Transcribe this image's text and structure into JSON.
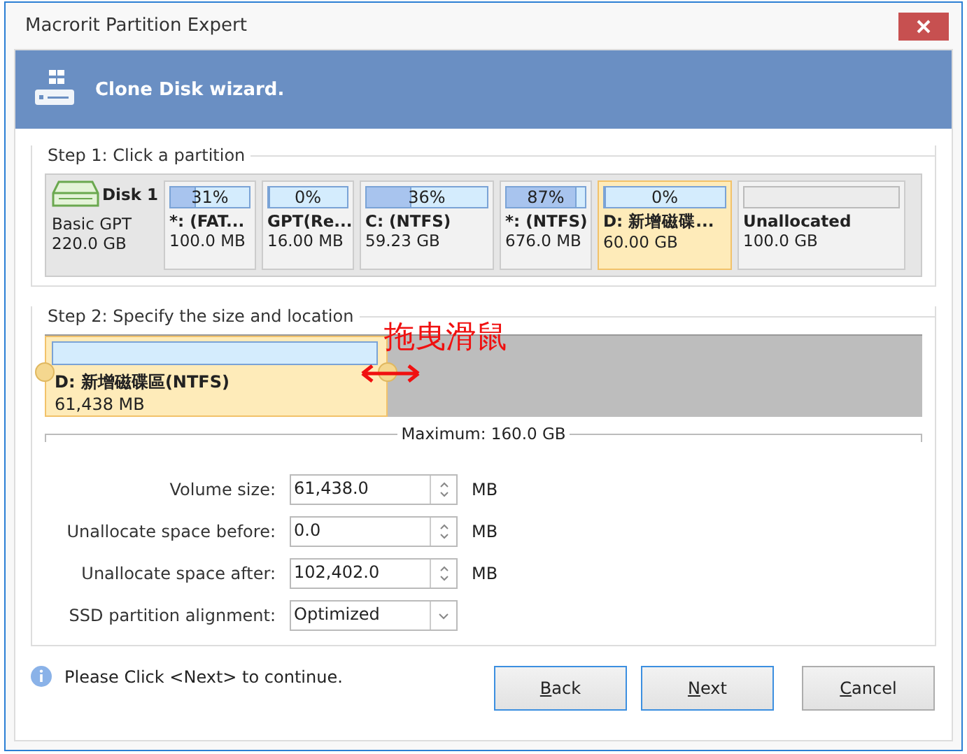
{
  "window": {
    "title": "Macrorit Partition Expert"
  },
  "header": {
    "title": "Clone Disk wizard."
  },
  "step1": {
    "legend": "Step 1: Click a partition",
    "disk": {
      "name": "Disk 1",
      "type": "Basic GPT",
      "size": "220.0 GB"
    },
    "partitions": [
      {
        "kind": "partition",
        "usage": "31%",
        "level": 0.31,
        "name": "*: (FAT...",
        "size": "100.0 MB",
        "selected": false
      },
      {
        "kind": "partition",
        "usage": "0%",
        "level": 0,
        "name": "GPT(Re...",
        "size": "16.00 MB",
        "selected": false
      },
      {
        "kind": "partition",
        "usage": "36%",
        "level": 0.36,
        "name": "C: (NTFS)",
        "size": "59.23 GB",
        "selected": false
      },
      {
        "kind": "partition",
        "usage": "87%",
        "level": 0.87,
        "name": "*: (NTFS)",
        "size": "676.0 MB",
        "selected": false
      },
      {
        "kind": "partition",
        "usage": "0%",
        "level": 0,
        "name": "D: 新增磁碟...",
        "size": "60.00 GB",
        "selected": true
      },
      {
        "kind": "unallocated",
        "name": "Unallocated",
        "size": "100.0 GB",
        "selected": false
      }
    ]
  },
  "step2": {
    "legend": "Step 2: Specify the size and location",
    "partition": {
      "name": "D: 新增磁碟區(NTFS)",
      "size": "61,438 MB",
      "level": 0.39
    },
    "annotation": "拖曳滑鼠",
    "maximum": "Maximum: 160.0 GB",
    "fields": [
      {
        "kind": "spin",
        "label": "Volume size:",
        "value": "61,438.0",
        "unit": "MB"
      },
      {
        "kind": "spin",
        "label": "Unallocate space before:",
        "value": "0.0",
        "unit": "MB"
      },
      {
        "kind": "spin",
        "label": "Unallocate space after:",
        "value": "102,402.0",
        "unit": "MB"
      },
      {
        "kind": "select",
        "label": "SSD partition alignment:",
        "value": "Optimized"
      }
    ]
  },
  "footer": {
    "info": "Please Click <Next> to continue.",
    "buttons": [
      {
        "label": "Back",
        "focused": true
      },
      {
        "label": "Next",
        "focused": true
      },
      {
        "label": "Cancel",
        "focused": false
      }
    ]
  }
}
